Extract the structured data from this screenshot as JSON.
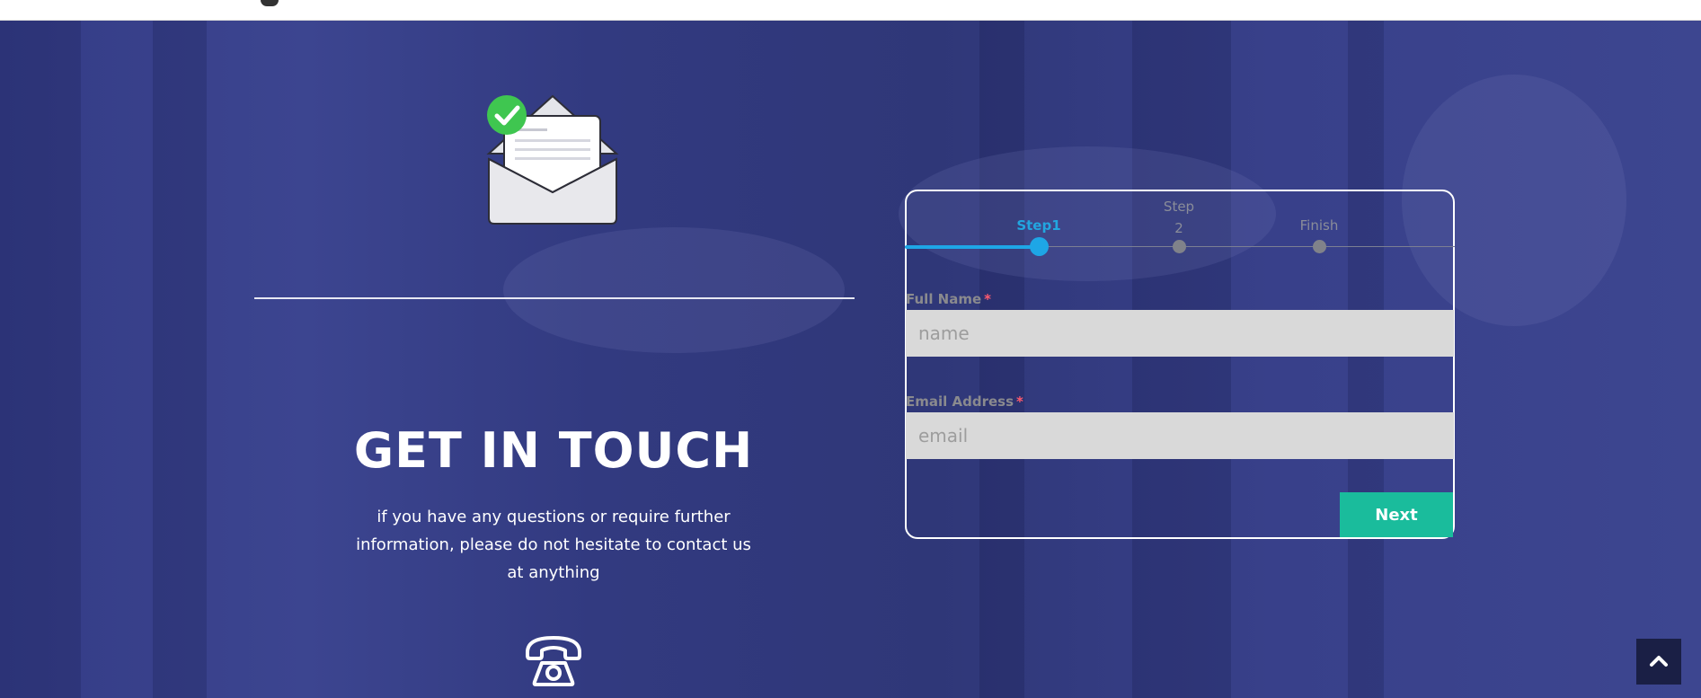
{
  "hero": {
    "heading": "GET IN TOUCH",
    "description": "if you have any questions or require further information, please do not hesitate to contact us at anything"
  },
  "form": {
    "steps": [
      {
        "label": "Step1",
        "active": true
      },
      {
        "label": "Step 2",
        "active": false
      },
      {
        "label": "Finish",
        "active": false
      }
    ],
    "full_name_label": "Full Name",
    "full_name_placeholder": "name",
    "email_label": "Email Address",
    "email_placeholder": "email",
    "required_marker": "*",
    "next_label": "Next",
    "progress": 0.25
  },
  "icons": {
    "envelope": "envelope-check-icon",
    "phone": "telephone-icon",
    "scroll_top": "chevron-up-icon"
  },
  "colors": {
    "overlay": "#2e3679",
    "step_active": "#1ea6e6",
    "next_button": "#1abc9c",
    "input_bg": "#d9d9d9",
    "required": "#ff5a6e"
  }
}
